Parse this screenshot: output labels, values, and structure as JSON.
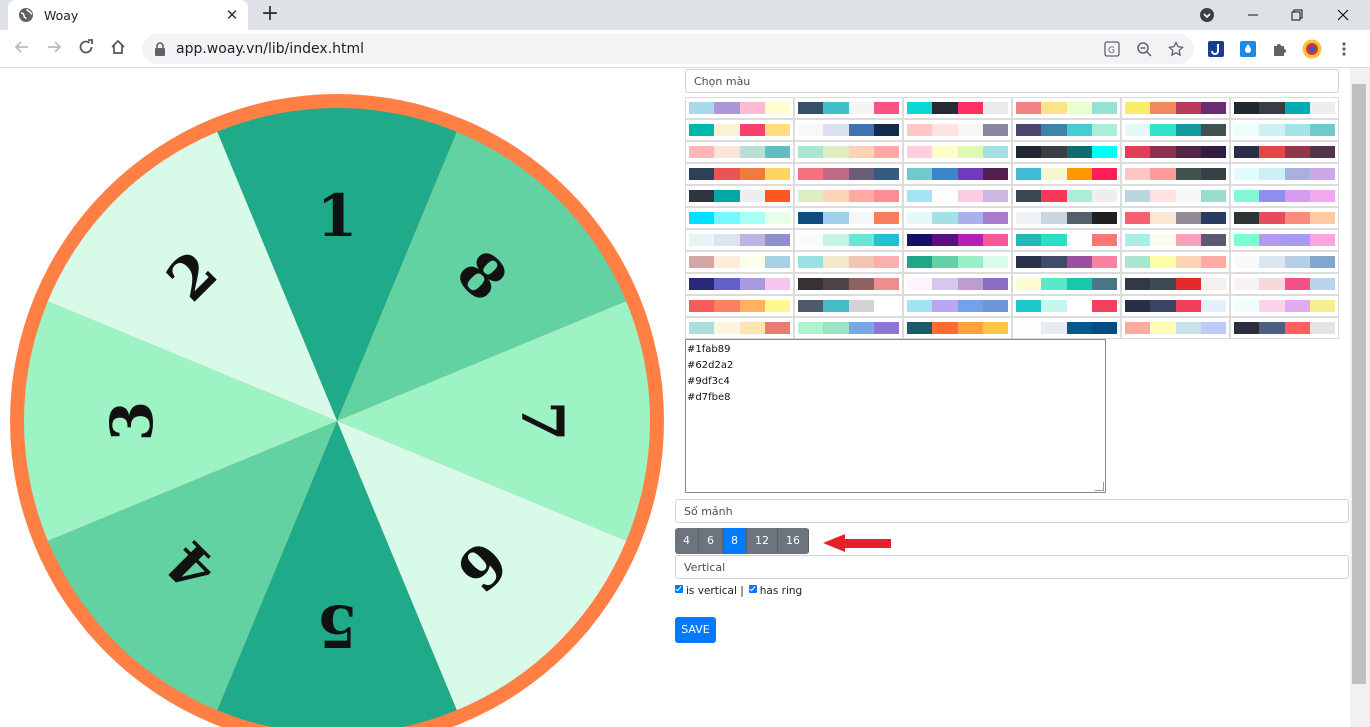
{
  "browser": {
    "tab_title": "Woay",
    "tab_close": "✕",
    "new_tab": "+",
    "url": "app.woay.vn/lib/index.html"
  },
  "wheel": {
    "segments": [
      {
        "label": "1",
        "color": "#1fab89"
      },
      {
        "label": "8",
        "color": "#62d2a2"
      },
      {
        "label": "7",
        "color": "#9df3c4"
      },
      {
        "label": "6",
        "color": "#d7fbe8"
      },
      {
        "label": "5",
        "color": "#1fab89"
      },
      {
        "label": "4",
        "color": "#62d2a2"
      },
      {
        "label": "3",
        "color": "#9df3c4"
      },
      {
        "label": "2",
        "color": "#d7fbe8"
      }
    ],
    "ring_color": "#ff7f45"
  },
  "panel": {
    "color_placeholder": "Chọn màu",
    "palettes": [
      [
        "#a8d8ea",
        "#aa96da",
        "#fcbad3",
        "#ffffd2"
      ],
      [
        "#364f6b",
        "#3fc1c9",
        "#f5f5f5",
        "#fc5185"
      ],
      [
        "#08d9d6",
        "#252a34",
        "#ff2e63",
        "#eaeaea"
      ],
      [
        "#f38181",
        "#fce38a",
        "#eaffd0",
        "#95e1d3"
      ],
      [
        "#f9ed69",
        "#f08a5d",
        "#b83b5e",
        "#6a2c70"
      ],
      [
        "#222831",
        "#393e46",
        "#00adb5",
        "#eeeeee"
      ],
      [
        "#00b8a9",
        "#f8f3d4",
        "#f6416c",
        "#ffde7d"
      ],
      [
        "#f9f7f7",
        "#dbe2ef",
        "#3f72af",
        "#112d4e"
      ],
      [
        "#ffc7c7",
        "#ffe2e2",
        "#f6f6f6",
        "#8785a2"
      ],
      [
        "#48466d",
        "#3d84a8",
        "#46cdcf",
        "#abedd8"
      ],
      [
        "#e4f9f5",
        "#30e3ca",
        "#11999e",
        "#40514e"
      ],
      [
        "#ecfffb",
        "#cbf1f5",
        "#a6e3e9",
        "#71c9ce"
      ],
      [
        "#ffb6b9",
        "#fae3d9",
        "#bbded6",
        "#61c0bf"
      ],
      [
        "#a8e6cf",
        "#dcedc1",
        "#ffd3b6",
        "#ffaaa5"
      ],
      [
        "#ffcfdf",
        "#fefdca",
        "#e0f9b5",
        "#a5dee5"
      ],
      [
        "#222831",
        "#393e46",
        "#0e6c6c",
        "#00fff5"
      ],
      [
        "#e23e57",
        "#88304e",
        "#522546",
        "#311d3f"
      ],
      [
        "#2b2e4a",
        "#e84545",
        "#903749",
        "#53354a"
      ],
      [
        "#2d4059",
        "#ea5455",
        "#f07b3f",
        "#ffd460"
      ],
      [
        "#f67280",
        "#c06c84",
        "#6c5b7b",
        "#355c7d"
      ],
      [
        "#71c9ce",
        "#3a86c8",
        "#6e3cbc",
        "#511f4d"
      ],
      [
        "#40bad5",
        "#f6f5d0",
        "#fe9801",
        "#ff1e56"
      ],
      [
        "#ffc4c4",
        "#ff9a9a",
        "#40514e",
        "#374045"
      ],
      [
        "#e3fdfd",
        "#cbf1f5",
        "#a6b1e1",
        "#cca8e9"
      ],
      [
        "#2f3640",
        "#00a8a8",
        "#eeeeee",
        "#ff5722"
      ],
      [
        "#dcedc1",
        "#ffd3b6",
        "#ffaaa5",
        "#ff8b94"
      ],
      [
        "#a2e4f4",
        "#fdfdfd",
        "#fccde2",
        "#cbb7e0"
      ],
      [
        "#3a4750",
        "#f73859",
        "#abedd8",
        "#eeeeee"
      ],
      [
        "#bad7df",
        "#ffe2e2",
        "#f6f6f6",
        "#99ddcc"
      ],
      [
        "#83f8d6",
        "#908cf1",
        "#d49bf0",
        "#f2a8f0"
      ],
      [
        "#00e0ff",
        "#74f9ff",
        "#a6fff2",
        "#e8ffe8"
      ],
      [
        "#0f4c81",
        "#a3cfef",
        "#f6f6f6",
        "#fa7d5e"
      ],
      [
        "#e4f9f5",
        "#a3e1e6",
        "#a9b0ec",
        "#a97bcd"
      ],
      [
        "#eef2f5",
        "#c9d6df",
        "#52616b",
        "#1e2022"
      ],
      [
        "#f85f73",
        "#fbe8d3",
        "#928a97",
        "#283c63"
      ],
      [
        "#2d3436",
        "#e84b5f",
        "#fc8a7d",
        "#ffcba4"
      ],
      [
        "#e3f6f5",
        "#dde4f0",
        "#b9b7e0",
        "#8c8fcb"
      ],
      [
        "#f8fcfb",
        "#c4f4e0",
        "#6be6d4",
        "#1fc2d0"
      ],
      [
        "#130f6b",
        "#5c1181",
        "#b620b6",
        "#f9599a"
      ],
      [
        "#25b8b8",
        "#29e1c0",
        "#fcfcfc",
        "#f87674"
      ],
      [
        "#a9eee6",
        "#fefaec",
        "#f9a1bc",
        "#625772"
      ],
      [
        "#77ffd2",
        "#b299f0",
        "#a79af2",
        "#ffa4e0"
      ],
      [
        "#d4a5a5",
        "#ffecda",
        "#f9ffea",
        "#a6d0e4"
      ],
      [
        "#99e1e5",
        "#f3e8cb",
        "#f2c6b4",
        "#fbafaf"
      ],
      [
        "#20a689",
        "#64d1a5",
        "#98f0c8",
        "#dafbe8"
      ],
      [
        "#283149",
        "#404b69",
        "#9c51a0",
        "#f882a4"
      ],
      [
        "#a8e6cf",
        "#fdffab",
        "#ffd3b6",
        "#ffaaa5"
      ],
      [
        "#f9f9f9",
        "#dbe6ef",
        "#b6cfe6",
        "#83a6cf"
      ],
      [
        "#29297c",
        "#6161c7",
        "#a699e0",
        "#f7c4f1"
      ],
      [
        "#393232",
        "#4d4545",
        "#8d6262",
        "#ed8d8d"
      ],
      [
        "#fdf4fd",
        "#d5c7f2",
        "#bb9ecf",
        "#8a6dc4"
      ],
      [
        "#fcfcd0",
        "#5ae8c6",
        "#19c7aa",
        "#4a7689"
      ],
      [
        "#323944",
        "#404a55",
        "#e32b2b",
        "#f1f1f1"
      ],
      [
        "#f9f3f3",
        "#f7d9d9",
        "#f25287",
        "#bad4ed"
      ],
      [
        "#f65b5b",
        "#fb8162",
        "#ffb15f",
        "#fef88f"
      ],
      [
        "#4e5a6a",
        "#42bcc7",
        "#d4d4d4",
        "#ffffff"
      ],
      [
        "#a0e4f3",
        "#b8a7f0",
        "#73a1ec",
        "#6f95d8"
      ],
      [
        "#1dc9c9",
        "#c5f7ef",
        "#ffffff",
        "#f1405e"
      ],
      [
        "#283047",
        "#3a4566",
        "#f03e5a",
        "#e3f0f9"
      ],
      [
        "#effdfd",
        "#fed2e9",
        "#e3aaf0",
        "#f6ef90"
      ],
      [
        "#a9dedb",
        "#fff5e0",
        "#ffe4b2",
        "#e97b75"
      ],
      [
        "#b1f5d0",
        "#9ce3c4",
        "#77a8e2",
        "#8f75d4"
      ],
      [
        "#1b5969",
        "#fc6b32",
        "#fea13c",
        "#ffc64a"
      ],
      [
        "#fcfcfc",
        "#e6ecf3",
        "#045a8d",
        "#024c7f"
      ],
      [
        "#fca9a0",
        "#fefeb6",
        "#c6e4e8",
        "#bfcaf8"
      ],
      [
        "#2e2f3e",
        "#4d5f81",
        "#ff5f5f",
        "#e4e4e4"
      ]
    ],
    "textarea_value": "#1fab89\n#62d2a2\n#9df3c4\n#d7fbe8",
    "pieces_placeholder": "Số mảnh",
    "piece_options": [
      "4",
      "6",
      "8",
      "12",
      "16"
    ],
    "active_piece": "8",
    "orientation_value": "Vertical",
    "is_vertical_label": "is vertical |",
    "has_ring_label": "has ring",
    "save_label": "SAVE"
  }
}
